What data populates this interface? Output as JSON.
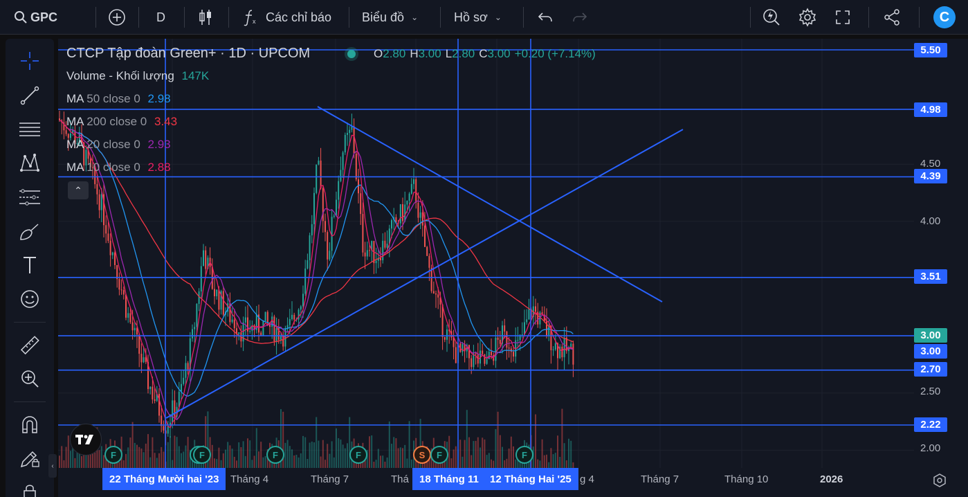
{
  "toolbar": {
    "symbol": "GPC",
    "interval": "D",
    "indicators_label": "Các chỉ báo",
    "chart_label": "Biểu đồ",
    "profile_label": "Hồ sơ"
  },
  "legend": {
    "title": "CTCP Tập đoàn Green+ · 1D · UPCOM",
    "ohlc": {
      "o_label": "O",
      "o": "2.80",
      "h_label": "H",
      "h": "3.00",
      "l_label": "L",
      "l": "2.80",
      "c_label": "C",
      "c": "3.00",
      "change": "+0.20 (+7.14%)"
    },
    "volume": {
      "label": "Volume - Khối lượng",
      "value": "147K",
      "color": "#26a69a"
    },
    "mas": [
      {
        "name": "MA",
        "params": "50 close 0",
        "value": "2.98",
        "color": "#2196f3"
      },
      {
        "name": "MA",
        "params": "200 close 0",
        "value": "3.43",
        "color": "#f23645"
      },
      {
        "name": "MA",
        "params": "20 close 0",
        "value": "2.93",
        "color": "#9c27b0"
      },
      {
        "name": "MA",
        "params": "10 close 0",
        "value": "2.88",
        "color": "#e91e63"
      }
    ]
  },
  "price_axis": {
    "ticks": [
      "4.50",
      "4.00",
      "2.50",
      "2.00"
    ],
    "levels": [
      {
        "value": "5.50",
        "style": "blue"
      },
      {
        "value": "4.98",
        "style": "blue"
      },
      {
        "value": "4.39",
        "style": "blue"
      },
      {
        "value": "3.51",
        "style": "blue"
      },
      {
        "value": "3.00",
        "style": "green"
      },
      {
        "value": "3.00",
        "style": "blue"
      },
      {
        "value": "2.70",
        "style": "blue"
      },
      {
        "value": "2.22",
        "style": "blue"
      }
    ]
  },
  "time_axis": {
    "ticks": [
      "Tháng 4",
      "Tháng 7",
      "Thá",
      "g 4",
      "Tháng 7",
      "Tháng 10",
      "2026"
    ],
    "crosshair_labels": [
      "22 Tháng Mười hai '23",
      "18 Tháng 11",
      "12 Tháng Hai '25"
    ]
  },
  "events": [
    "F",
    "F",
    "F",
    "F",
    "F",
    "S",
    "F",
    "F"
  ],
  "chart_data": {
    "type": "candlestick",
    "title": "CTCP Tập đoàn Green+ · 1D · UPCOM",
    "ylim": [
      1.85,
      5.6
    ],
    "horizontal_levels": [
      5.5,
      4.98,
      4.39,
      3.51,
      3.0,
      2.7,
      2.22
    ],
    "last": {
      "open": 2.8,
      "high": 3.0,
      "low": 2.8,
      "close": 3.0,
      "change": 0.2,
      "change_pct": 7.14
    },
    "series": [
      {
        "name": "MA 50 close 0",
        "last": 2.98
      },
      {
        "name": "MA 200 close 0",
        "last": 3.43
      },
      {
        "name": "MA 20 close 0",
        "last": 2.93
      },
      {
        "name": "MA 10 close 0",
        "last": 2.88
      }
    ],
    "volume_last": "147K"
  },
  "colors": {
    "up": "#26a69a",
    "down": "#ef5350",
    "drawing": "#2962ff",
    "background": "#131722"
  }
}
